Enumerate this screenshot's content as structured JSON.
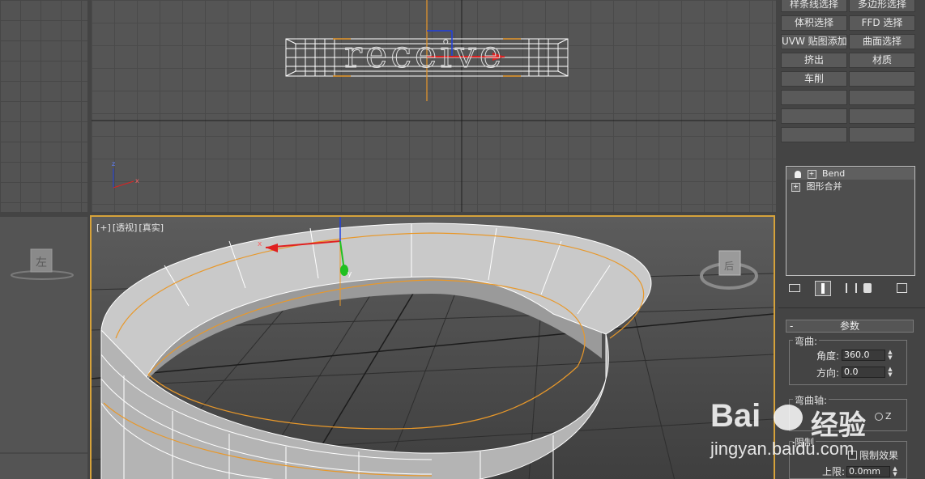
{
  "modifier_buttons": [
    {
      "label": "样条线选择"
    },
    {
      "label": "多边形选择"
    },
    {
      "label": "体积选择"
    },
    {
      "label": "FFD 选择"
    },
    {
      "label": "UVW 贴图添加"
    },
    {
      "label": "曲面选择"
    },
    {
      "label": "挤出"
    },
    {
      "label": "材质"
    },
    {
      "label": "车削"
    },
    {
      "label": ""
    },
    {
      "label": ""
    },
    {
      "label": ""
    },
    {
      "label": ""
    },
    {
      "label": ""
    },
    {
      "label": ""
    },
    {
      "label": ""
    }
  ],
  "modifier_stack": [
    {
      "label": "Bend"
    },
    {
      "label": "图形合并"
    }
  ],
  "viewport_persp": {
    "plus": "[+]",
    "view": "[透视]",
    "shading": "[真实]"
  },
  "viewcube_left": {
    "label": "左"
  },
  "viewcube_persp": {
    "label": "后"
  },
  "front_text": {
    "label": "receive"
  },
  "params": {
    "rollout_title": "参数",
    "bend_group": "弯曲:",
    "angle_label": "角度:",
    "angle_value": "360.0",
    "direction_label": "方向:",
    "direction_value": "0.0",
    "axis_group": "弯曲轴:",
    "axis_z": "Z",
    "limit_group": "限制",
    "limit_effect": "限制效果",
    "upper_label": "上限:",
    "upper_value": "0.0mm"
  },
  "watermark": {
    "brand": "Bai",
    "brand_cn": "经验",
    "url": "jingyan.baidu.com"
  },
  "colors": {
    "selection_orange": "#e8982a",
    "active_border": "#d6a23a",
    "axis_x": "#e02020",
    "axis_y": "#20c020",
    "axis_z": "#2040e0"
  }
}
